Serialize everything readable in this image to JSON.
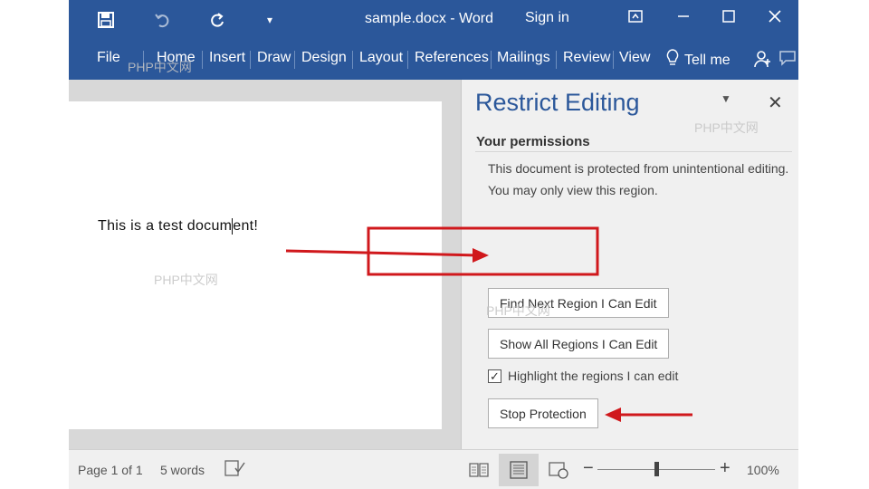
{
  "title_bar": {
    "document_title": "sample.docx  -  Word",
    "sign_in": "Sign in",
    "save_icon": "save-icon",
    "undo_icon": "undo-icon",
    "redo_icon": "redo-icon",
    "customize_icon": "customize-quick-access-icon",
    "ribbon_display_icon": "ribbon-display-options-icon",
    "minimize_icon": "minimize-icon",
    "maximize_icon": "maximize-icon",
    "close_icon": "close-icon"
  },
  "ribbon": {
    "tabs": [
      "File",
      "Home",
      "Insert",
      "Draw",
      "Design",
      "Layout",
      "References",
      "Mailings",
      "Review",
      "View"
    ],
    "tell_me": "Tell me",
    "share_icon": "share-person-icon",
    "comments_icon": "comments-icon"
  },
  "document": {
    "text_before_cursor": "This is a test docum",
    "text_after_cursor": "ent!"
  },
  "restrict_pane": {
    "title": "Restrict Editing",
    "heading": "Your permissions",
    "message_line1": "This document is protected from unintentional editing.",
    "message_line2": "You may only view this region.",
    "find_next_button": "Find Next Region I Can Edit",
    "show_all_button": "Show All Regions I Can Edit",
    "highlight_label": "Highlight the regions I can edit",
    "highlight_checked": true,
    "stop_button": "Stop Protection"
  },
  "status_bar": {
    "page": "Page 1 of 1",
    "words": "5 words",
    "zoom": "100%"
  },
  "annotations": {
    "color": "#d0181c"
  },
  "watermarks": [
    "PHP中文网"
  ]
}
